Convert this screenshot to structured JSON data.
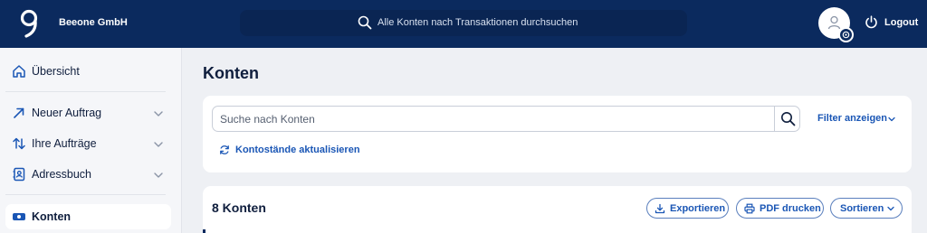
{
  "header": {
    "company_name": "Beeone GmbH",
    "search_placeholder": "Alle Konten nach Transaktionen durchsuchen",
    "logout_label": "Logout"
  },
  "sidebar": {
    "items": [
      {
        "label": "Übersicht",
        "icon": "home-icon"
      },
      {
        "label": "Neuer Auftrag",
        "icon": "arrow-up-right-icon"
      },
      {
        "label": "Ihre Aufträge",
        "icon": "sort-arrows-icon"
      },
      {
        "label": "Adressbuch",
        "icon": "address-book-icon"
      },
      {
        "label": "Konten",
        "icon": "account-card-icon"
      }
    ]
  },
  "main": {
    "title": "Konten",
    "account_search_placeholder": "Suche nach Konten",
    "filter_label": "Filter anzeigen",
    "refresh_label": "Kontostände aktualisieren",
    "accounts_count_title": "8 Konten",
    "actions": {
      "export_label": "Exportieren",
      "print_label": "PDF drucken",
      "sort_label": "Sortieren"
    }
  },
  "colors": {
    "header_bg": "#0b2a5e",
    "accent": "#1a56b5",
    "page_bg": "#eef0f4"
  }
}
